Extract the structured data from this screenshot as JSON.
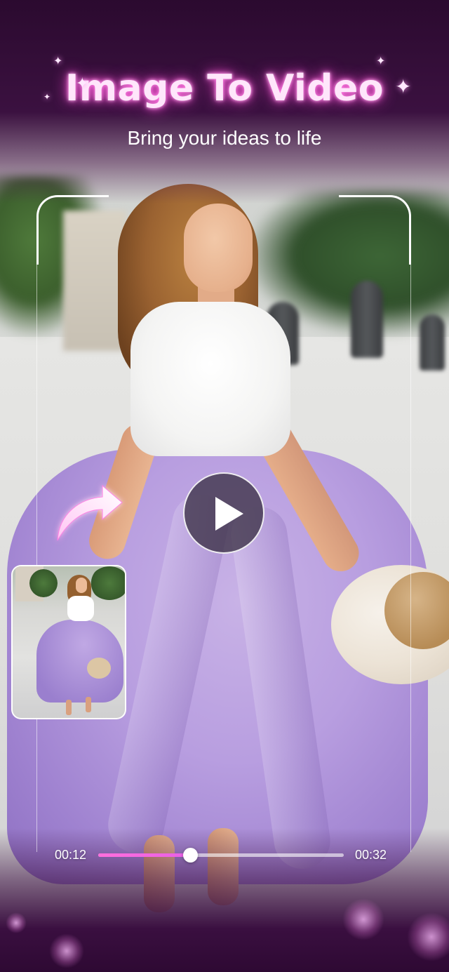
{
  "header": {
    "title": "Image To Video",
    "subtitle": "Bring your ideas to life"
  },
  "player": {
    "current_time": "00:12",
    "total_time": "00:32",
    "progress": 0.375
  },
  "icons": {
    "play": "play-icon",
    "arrow": "curved-arrow-icon",
    "sparkle": "sparkle-icon"
  },
  "colors": {
    "title_glow": "#ff47d3",
    "progress_fill": "#ff6fdc",
    "background_dark": "#2e0933"
  }
}
